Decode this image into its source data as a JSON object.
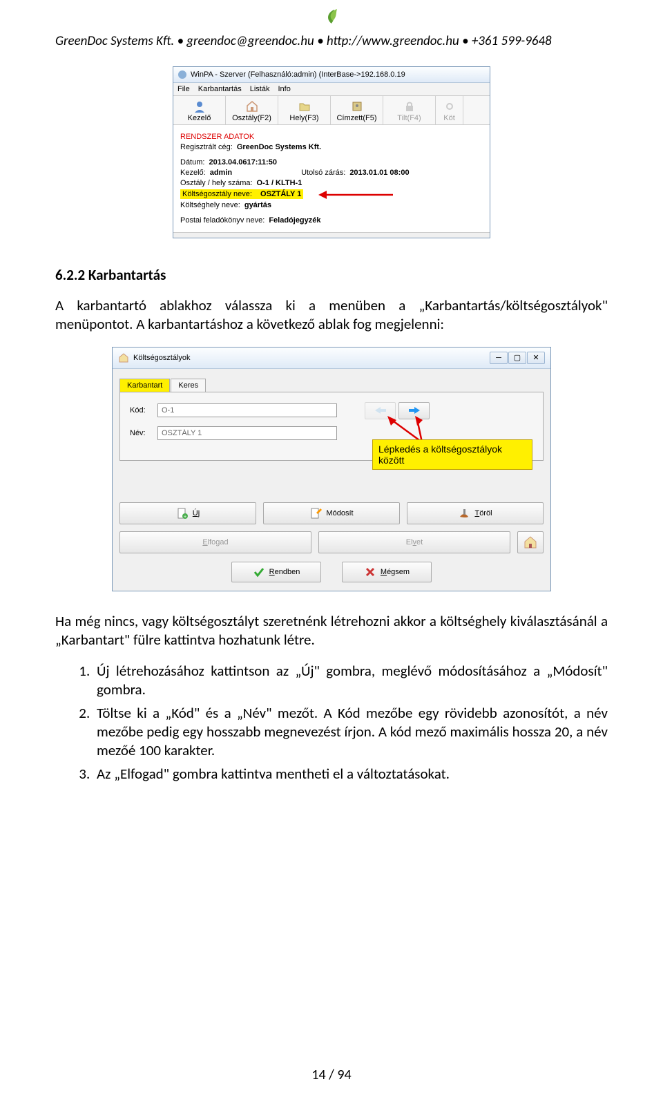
{
  "header": {
    "company": "GreenDoc Systems Kft.",
    "email": "greendoc@greendoc.hu",
    "url": "http://www.greendoc.hu",
    "phone": "+361 599-9648",
    "sep": "•"
  },
  "win1": {
    "title": "WinPA - Szerver (Felhasználó:admin)  (InterBase->192.168.0.19",
    "menu": [
      "File",
      "Karbantartás",
      "Listák",
      "Info"
    ],
    "toolbar": [
      {
        "label": "Kezelő",
        "dis": false
      },
      {
        "label": "Osztály(F2)",
        "dis": false
      },
      {
        "label": "Hely(F3)",
        "dis": false
      },
      {
        "label": "Címzett(F5)",
        "dis": false
      },
      {
        "label": "Tilt(F4)",
        "dis": true
      },
      {
        "label": "Köt",
        "dis": true
      }
    ],
    "section": "RENDSZER ADATOK",
    "fields": {
      "reg_lbl": "Regisztrált cég:",
      "reg_val": "GreenDoc Systems Kft.",
      "date_lbl": "Dátum:",
      "date_val": "2013.04.0617:11:50",
      "kez_lbl": "Kezelő:",
      "kez_val": "admin",
      "uzar_lbl": "Utolsó zárás:",
      "uzar_val": "2013.01.01 08:00",
      "ohely_lbl": "Osztály / hely száma:",
      "ohely_val": "O-1 / KLTH-1",
      "kosz_lbl": "Költségosztály neve:",
      "kosz_val": "OSZTÁLY 1",
      "khely_lbl": "Költséghely neve:",
      "khely_val": "gyártás",
      "post_lbl": "Postai feladókönyv neve:",
      "post_val": "Feladójegyzék"
    }
  },
  "section_heading": "6.2.2 Karbantartás",
  "para1": "A karbantartó ablakhoz válassza ki a menüben a „Karbantartás/költségosztályok\" menüpontot. A karbantartáshoz a következő ablak fog megjelenni:",
  "win2": {
    "title": "Költségosztályok",
    "tabs": [
      "Karbantart",
      "Keres"
    ],
    "kod_lbl": "Kód:",
    "kod_val": "O-1",
    "nev_lbl": "Név:",
    "nev_val": "OSZTÁLY 1",
    "callout": "Lépkedés a költségosztályok között",
    "btns": {
      "uj": "Új",
      "modosit": "Módosít",
      "torol": "Töröl",
      "elfogad": "Elfogad",
      "elvet": "Elvet",
      "rendben": "Rendben",
      "megsem": "Mégsem"
    }
  },
  "para2": "Ha még nincs, vagy költségosztályt szeretnénk létrehozni akkor a költséghely kiválasztásánál a „Karbantart\" fülre kattintva hozhatunk létre.",
  "list": [
    "Új létrehozásához kattintson az „Új\" gombra, meglévő módosításához a „Módosít\" gombra.",
    "Töltse ki a „Kód\" és a „Név\" mezőt. A Kód mezőbe egy rövidebb azonosítót, a név mezőbe pedig egy hosszabb megnevezést írjon. A kód mező maximális hossza 20, a név mezőé 100 karakter.",
    "Az „Elfogad\" gombra kattintva mentheti el a változtatásokat."
  ],
  "footer": "14 / 94"
}
